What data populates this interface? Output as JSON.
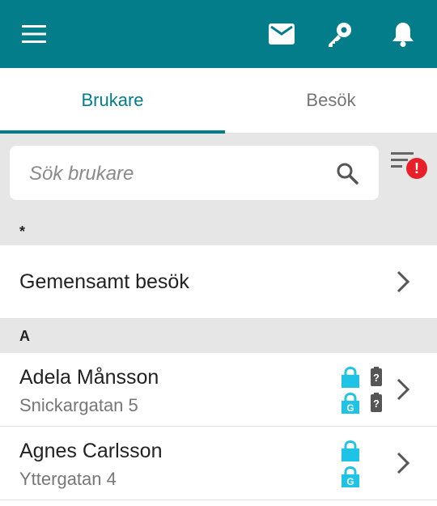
{
  "header": {
    "icons": [
      "menu-icon",
      "mail-icon",
      "key-icon",
      "bell-icon"
    ]
  },
  "tabs": [
    {
      "label": "Brukare",
      "active": true
    },
    {
      "label": "Besök",
      "active": false
    }
  ],
  "search": {
    "placeholder": "Sök brukare",
    "value": ""
  },
  "filter": {
    "badge": "!"
  },
  "sections": [
    {
      "header": "*",
      "rows": [
        {
          "label": "Gemensamt besök"
        }
      ]
    },
    {
      "header": "A",
      "rows": [
        {
          "name": "Adela Månsson",
          "address": "Snickargatan 5",
          "lock_label": "G",
          "status_icons": [
            "lock-icon",
            "lock-g-icon",
            "battery-unknown-icon",
            "battery-unknown-icon"
          ]
        },
        {
          "name": "Agnes Carlsson",
          "address": "Yttergatan 4",
          "lock_label": "G",
          "status_icons": [
            "lock-icon",
            "lock-g-icon"
          ]
        }
      ]
    }
  ],
  "colors": {
    "primary": "#047d8a",
    "lock": "#1ec3e6",
    "badge": "#e8202a",
    "section_bg": "#e6e6e6"
  }
}
